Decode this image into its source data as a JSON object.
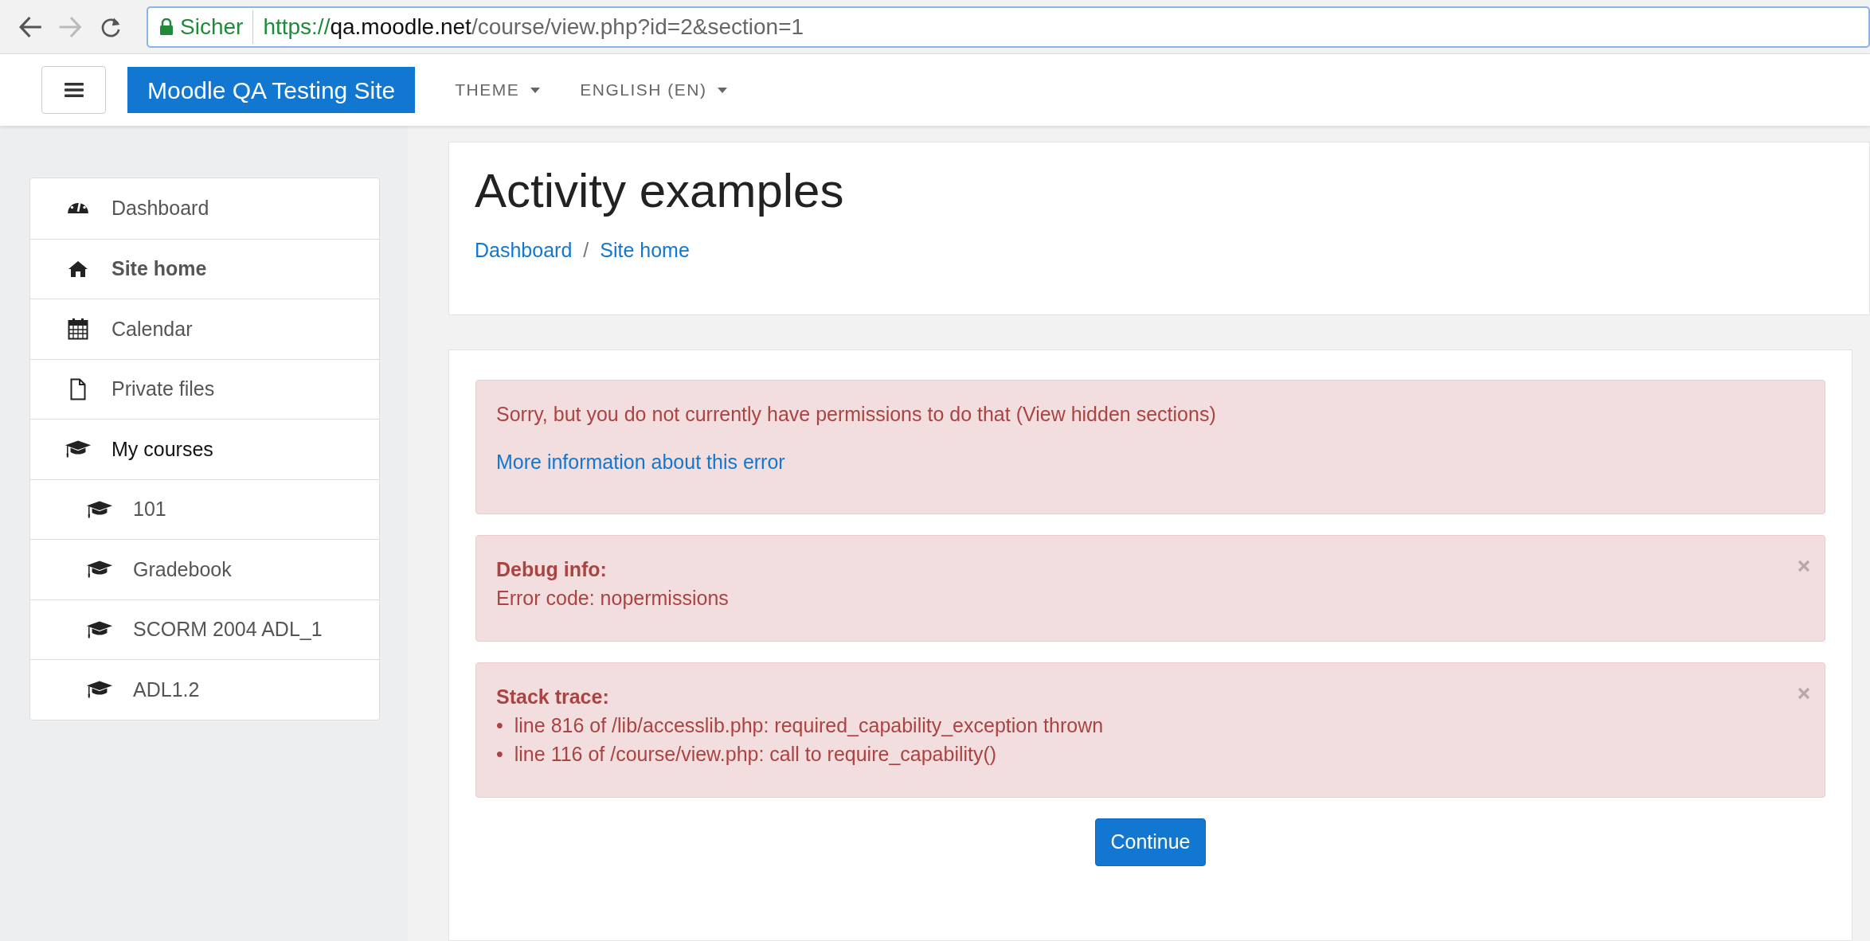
{
  "browser": {
    "back": {
      "disabled": false
    },
    "forward": {
      "disabled": true
    },
    "security_label": "Sicher",
    "url": {
      "scheme": "https://",
      "host": "qa.moodle.net",
      "path": "/course/view.php?id=2&section=1"
    }
  },
  "navbar": {
    "brand": "Moodle QA Testing Site",
    "menus": [
      "THEME",
      "ENGLISH (EN)"
    ]
  },
  "sidebar": {
    "items": [
      {
        "label": "Dashboard",
        "kind": "dashboard",
        "selected": false
      },
      {
        "label": "Site home",
        "kind": "home",
        "selected": true
      },
      {
        "label": "Calendar",
        "kind": "calendar",
        "selected": false
      },
      {
        "label": "Private files",
        "kind": "file",
        "selected": false
      },
      {
        "label": "My courses",
        "kind": "course",
        "selected": false,
        "children": [
          {
            "label": "101",
            "kind": "course",
            "selected": false
          },
          {
            "label": "Gradebook",
            "kind": "course",
            "selected": false
          },
          {
            "label": "SCORM 2004 ADL_1",
            "kind": "course",
            "selected": false
          },
          {
            "label": "ADL1.2",
            "kind": "course",
            "selected": false
          }
        ]
      }
    ]
  },
  "header": {
    "title": "Activity examples",
    "breadcrumb": [
      "Dashboard",
      "Site home"
    ],
    "separator": "/"
  },
  "alerts": [
    {
      "kind": "message",
      "dismissible": false,
      "text": "Sorry, but you do not currently have permissions to do that (View hidden sections)",
      "link": "More information about this error"
    },
    {
      "kind": "debug",
      "dismissible": true,
      "heading": "Debug info:",
      "text": "Error code: nopermissions"
    },
    {
      "kind": "trace",
      "dismissible": true,
      "heading": "Stack trace:",
      "bullet": "•",
      "lines": [
        "line 816 of /lib/accesslib.php: required_capability_exception thrown",
        "line 116 of /course/view.php: call to require_capability()"
      ]
    }
  ],
  "continue_button": "Continue"
}
